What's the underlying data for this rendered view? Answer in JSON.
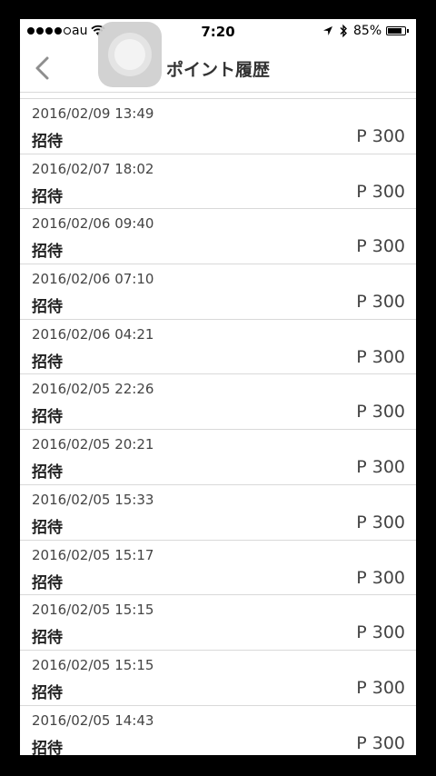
{
  "status_bar": {
    "carrier": "au",
    "time": "7:20",
    "battery": "85%",
    "battery_level": 0.85
  },
  "nav": {
    "title": "ポイント履歴"
  },
  "history": [
    {
      "date": "2016/02/09 13:49",
      "type": "招待",
      "points": "P 300"
    },
    {
      "date": "2016/02/07 18:02",
      "type": "招待",
      "points": "P 300"
    },
    {
      "date": "2016/02/06 09:40",
      "type": "招待",
      "points": "P 300"
    },
    {
      "date": "2016/02/06 07:10",
      "type": "招待",
      "points": "P 300"
    },
    {
      "date": "2016/02/06 04:21",
      "type": "招待",
      "points": "P 300"
    },
    {
      "date": "2016/02/05 22:26",
      "type": "招待",
      "points": "P 300"
    },
    {
      "date": "2016/02/05 20:21",
      "type": "招待",
      "points": "P 300"
    },
    {
      "date": "2016/02/05 15:33",
      "type": "招待",
      "points": "P 300"
    },
    {
      "date": "2016/02/05 15:17",
      "type": "招待",
      "points": "P 300"
    },
    {
      "date": "2016/02/05 15:15",
      "type": "招待",
      "points": "P 300"
    },
    {
      "date": "2016/02/05 15:15",
      "type": "招待",
      "points": "P 300"
    },
    {
      "date": "2016/02/05 14:43",
      "type": "招待",
      "points": "P 300"
    }
  ]
}
